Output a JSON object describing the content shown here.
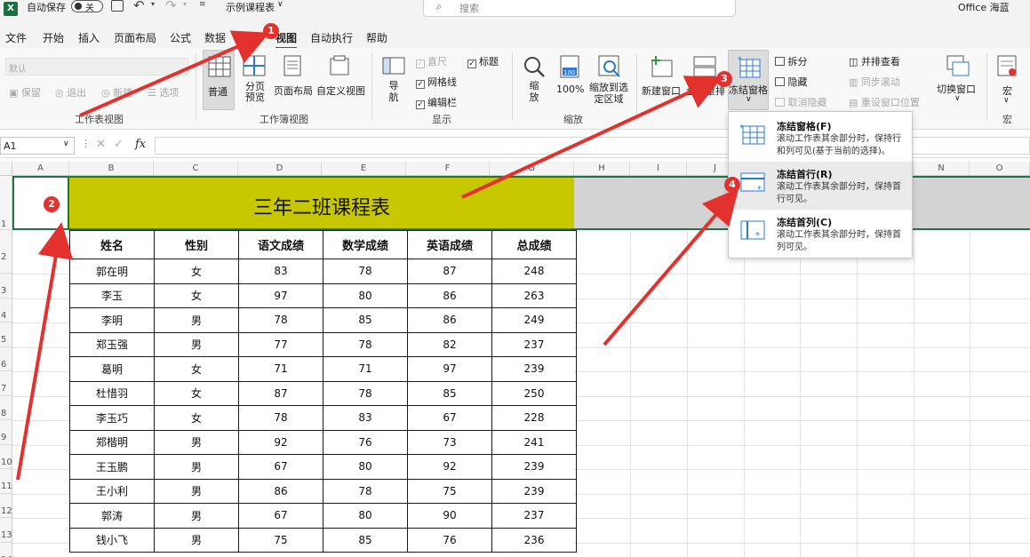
{
  "titlebar": {
    "autosave_label": "自动保存",
    "autosave_state": "关",
    "filename": "示例课程表",
    "search_placeholder": "搜索",
    "account": "Office 海蓝"
  },
  "menu": [
    "文件",
    "开始",
    "插入",
    "页面布局",
    "公式",
    "数据",
    "审阅",
    "视图",
    "自动执行",
    "帮助"
  ],
  "ribbon": {
    "sheet_view": {
      "dropdown_value": "默认",
      "keep": "保留",
      "exit": "退出",
      "new": "新建",
      "options": "选项",
      "label": "工作表视图"
    },
    "workbook_views": {
      "normal": "普通",
      "page_break": "分页预览",
      "page_layout": "页面布局",
      "custom": "自定义视图",
      "label": "工作簿视图"
    },
    "show": {
      "nav": "导航",
      "ruler": "直尺",
      "gridlines": "网格线",
      "formula_bar": "编辑栏",
      "headings": "标题",
      "label": "显示"
    },
    "zoom": {
      "zoom": "缩放",
      "hundred": "100%",
      "selection": "缩放到选定区域",
      "label": "缩放"
    },
    "window": {
      "new_window": "新建窗口",
      "arrange": "全部重排",
      "freeze": "冻结窗格",
      "split": "拆分",
      "hide": "隐藏",
      "unhide": "取消隐藏",
      "side_by_side": "并排查看",
      "sync_scroll": "同步滚动",
      "reset_pos": "重设窗口位置",
      "switch": "切换窗口",
      "label": "窗口"
    },
    "macros": {
      "macro": "宏",
      "label": "宏"
    }
  },
  "formula": {
    "namebox": "A1",
    "fx": "fx"
  },
  "sheet": {
    "columns": [
      "A",
      "B",
      "C",
      "D",
      "E",
      "F",
      "G",
      "H",
      "I",
      "J",
      "K",
      "L",
      "M",
      "N",
      "O"
    ],
    "rows": [
      "1",
      "2",
      "3",
      "4",
      "5",
      "6",
      "7",
      "8",
      "9",
      "10",
      "11",
      "12",
      "13",
      "14"
    ],
    "title": "三年二班课程表",
    "headers": [
      "姓名",
      "性别",
      "语文成绩",
      "数学成绩",
      "英语成绩",
      "总成绩"
    ],
    "data": [
      [
        "郭在明",
        "女",
        "83",
        "78",
        "87",
        "248"
      ],
      [
        "李玉",
        "女",
        "97",
        "80",
        "86",
        "263"
      ],
      [
        "李明",
        "男",
        "78",
        "85",
        "86",
        "249"
      ],
      [
        "郑玉强",
        "男",
        "77",
        "78",
        "82",
        "237"
      ],
      [
        "葛明",
        "女",
        "71",
        "71",
        "97",
        "239"
      ],
      [
        "杜惜羽",
        "女",
        "87",
        "78",
        "85",
        "250"
      ],
      [
        "李玉巧",
        "女",
        "78",
        "83",
        "67",
        "228"
      ],
      [
        "郑楷明",
        "男",
        "92",
        "76",
        "73",
        "241"
      ],
      [
        "王玉鹏",
        "男",
        "67",
        "80",
        "92",
        "239"
      ],
      [
        "王小利",
        "男",
        "86",
        "78",
        "75",
        "239"
      ],
      [
        "郭涛",
        "男",
        "67",
        "80",
        "90",
        "237"
      ],
      [
        "钱小飞",
        "男",
        "75",
        "85",
        "76",
        "236"
      ]
    ]
  },
  "freeze_menu": [
    {
      "title": "冻结窗格(F)",
      "desc": "滚动工作表其余部分时，保持行和列可见(基于当前的选择)。"
    },
    {
      "title": "冻结首行(R)",
      "desc": "滚动工作表其余部分时，保持首行可见。"
    },
    {
      "title": "冻结首列(C)",
      "desc": "滚动工作表其余部分时，保持首列可见。"
    }
  ],
  "badges": [
    "1",
    "2",
    "3",
    "4"
  ],
  "colors": {
    "title_fill": "#c8c800",
    "selection": "#217346",
    "arrow": "#e3312d",
    "icon_blue": "#2b79d0"
  }
}
